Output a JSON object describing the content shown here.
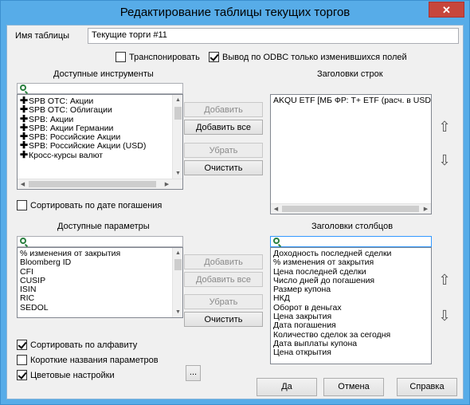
{
  "window": {
    "title": "Редактирование таблицы текущих торгов",
    "close_label": "✕"
  },
  "table_name": {
    "label": "Имя таблицы",
    "value": "Текущие торги #11"
  },
  "options": {
    "transpose": {
      "label": "Транспонировать",
      "checked": false
    },
    "odbc": {
      "label": "Вывод по ODBC только изменившихся  полей",
      "checked": true
    }
  },
  "instruments": {
    "title": "Доступные инструменты",
    "items": [
      "SPB OTC: Акции",
      "SPB OTC: Облигации",
      "SPB: Акции",
      "SPB: Акции Германии",
      "SPB: Российские  Акции",
      "SPB: Российские Акции (USD)",
      "Кросс-курсы валют"
    ],
    "sort_by_maturity": {
      "label": "Сортировать по дате погашения",
      "checked": false
    }
  },
  "instrument_buttons": {
    "add": "Добавить",
    "add_all": "Добавить все",
    "remove": "Убрать",
    "clear": "Очистить"
  },
  "row_headers": {
    "title": "Заголовки строк",
    "items": [
      "AKQU ETF [МБ ФР: Т+ ETF (расч. в USD)]"
    ]
  },
  "parameters": {
    "title": "Доступные параметры",
    "items": [
      "% изменения от закрытия",
      "Bloomberg ID",
      "CFI",
      "CUSIP",
      "ISIN",
      "RIC",
      "SEDOL"
    ],
    "sort_alpha": {
      "label": "Сортировать по алфавиту",
      "checked": true
    },
    "short_names": {
      "label": "Короткие названия параметров",
      "checked": false
    },
    "color_settings": {
      "label": "Цветовые настройки",
      "checked": true
    },
    "more_label": "..."
  },
  "parameter_buttons": {
    "add": "Добавить",
    "add_all": "Добавить все",
    "remove": "Убрать",
    "clear": "Очистить"
  },
  "column_headers": {
    "title": "Заголовки столбцов",
    "items": [
      "Доходность последней сделки",
      "% изменения от закрытия",
      "Цена последней сделки",
      "Число дней до погашения",
      "Размер купона",
      "НКД",
      "Оборот в деньгах",
      "Цена закрытия",
      "Дата погашения",
      "Количество сделок за сегодня",
      "Дата выплаты купона",
      "Цена открытия"
    ]
  },
  "footer": {
    "ok": "Да",
    "cancel": "Отмена",
    "help": "Справка"
  },
  "icons": {
    "search": "search-icon",
    "move_up": "arrow-up-icon",
    "move_down": "arrow-down-icon",
    "plus": "plus-icon"
  }
}
